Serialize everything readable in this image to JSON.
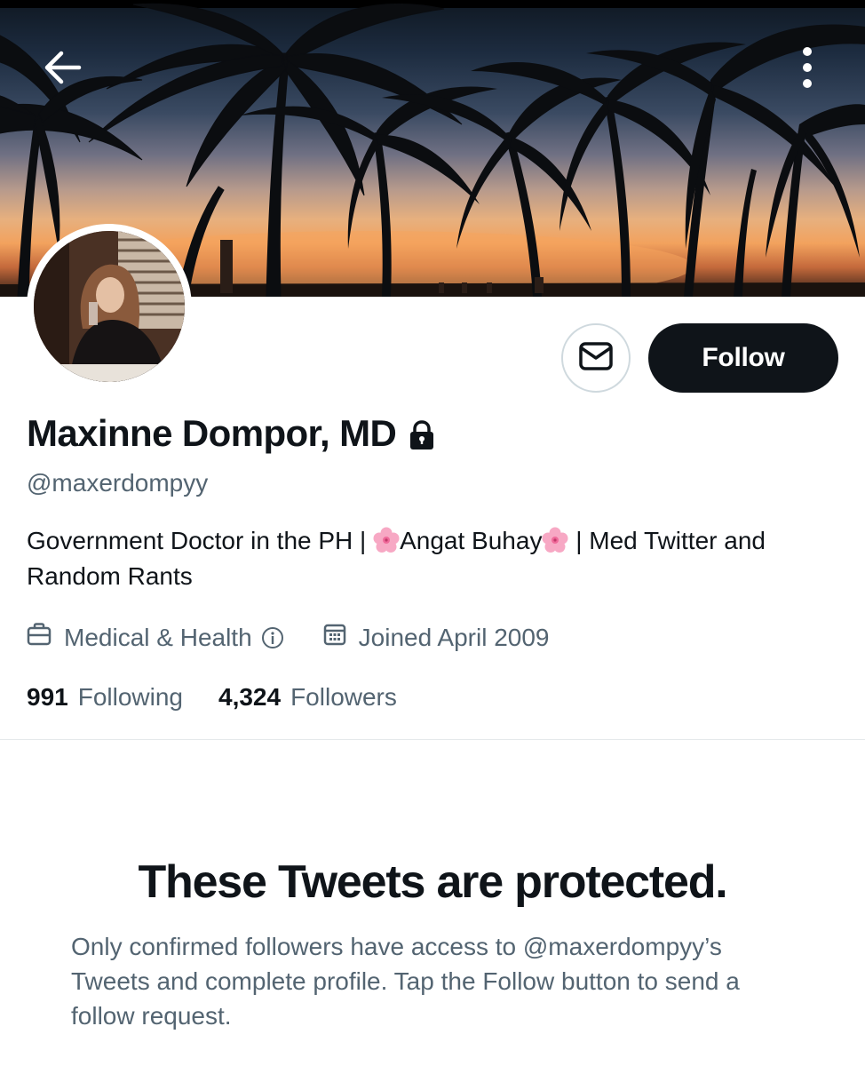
{
  "header": {
    "back_icon": "arrow-left-icon",
    "more_icon": "more-vertical-icon"
  },
  "profile": {
    "display_name": "Maxinne Dompor, MD",
    "handle": "@maxerdompyy",
    "protected_icon": "lock-icon",
    "bio": {
      "part1": "Government Doctor in the PH | ",
      "emoji": "cherry-blossom",
      "part2": "Angat Buhay",
      "part3": " | Med Twitter and Random Rants"
    },
    "category": "Medical & Health",
    "category_icon": "briefcase-icon",
    "joined": "Joined April 2009",
    "joined_icon": "calendar-icon"
  },
  "actions": {
    "message_icon": "envelope-icon",
    "follow_label": "Follow"
  },
  "stats": {
    "following_count": "991",
    "following_label": "Following",
    "followers_count": "4,324",
    "followers_label": "Followers"
  },
  "protected_notice": {
    "title": "These Tweets are protected.",
    "description": "Only confirmed followers have access to @maxerdompyy’s Tweets and complete profile. Tap the Follow button to send a follow request."
  },
  "colors": {
    "primary_text": "#0f1419",
    "secondary_text": "#536471",
    "button_bg": "#0f1419",
    "border": "#cfd9de"
  }
}
